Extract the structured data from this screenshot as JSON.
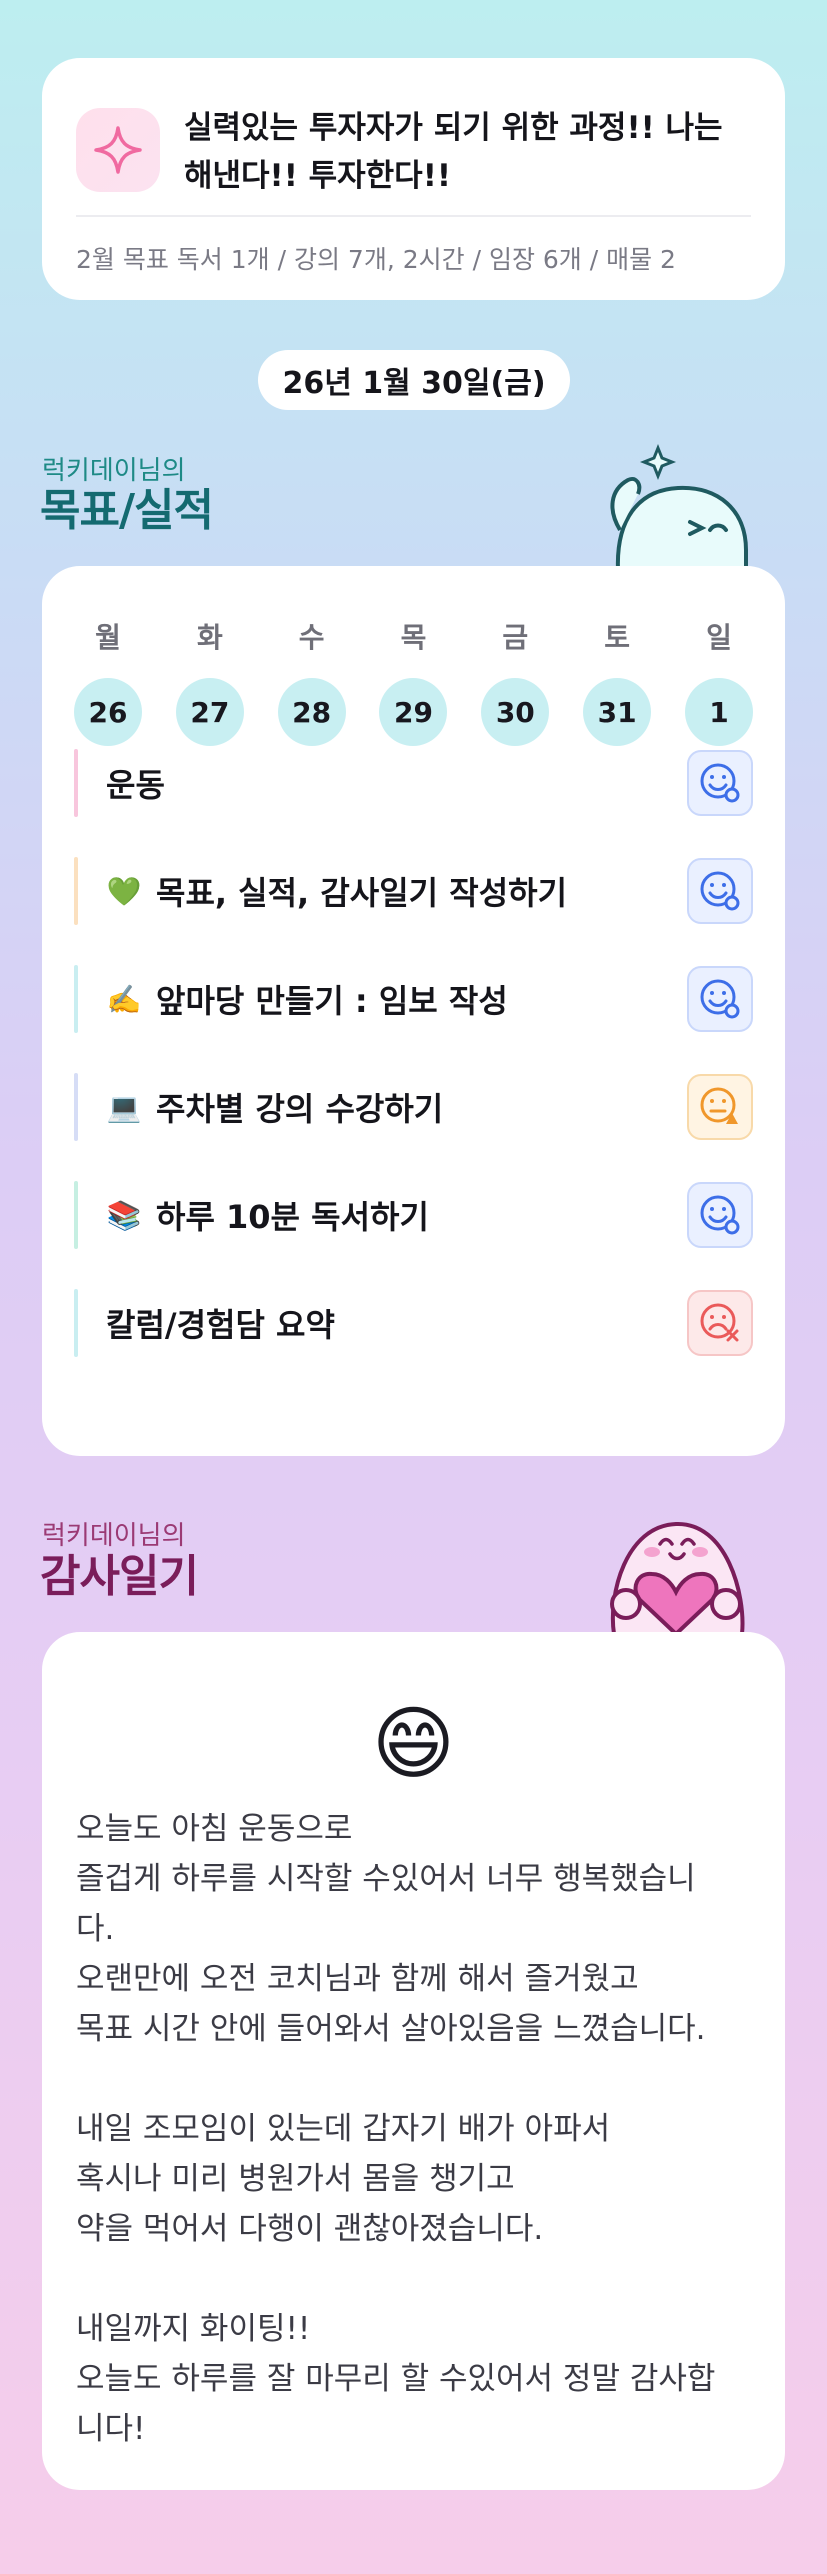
{
  "goal": {
    "text": "실력있는 투자자가 되기 위한 과정!! 나는 해낸다!! 투자한다!!",
    "subtitle": "2월 목표  독서 1개 / 강의 7개, 2시간 / 임장 6개 / 매물 2",
    "icon": "sparkle-icon",
    "accent": "#f06aa0"
  },
  "date": "26년 1월 30일(금)",
  "goals_section": {
    "small_title": "럭키데이님의",
    "big_title": "목표/실적"
  },
  "week": [
    {
      "day": "월",
      "date": "26"
    },
    {
      "day": "화",
      "date": "27"
    },
    {
      "day": "수",
      "date": "28"
    },
    {
      "day": "목",
      "date": "29"
    },
    {
      "day": "금",
      "date": "30"
    },
    {
      "day": "토",
      "date": "31"
    },
    {
      "day": "일",
      "date": "1"
    }
  ],
  "tasks": [
    {
      "emoji": "",
      "label": "운동",
      "status": "good",
      "bar_color": "#f8c6dd"
    },
    {
      "emoji": "💚",
      "label": "목표, 실적, 감사일기 작성하기",
      "status": "good",
      "bar_color": "#fbe0bf"
    },
    {
      "emoji": "✍️",
      "label": "앞마당 만들기 : 임보 작성",
      "status": "good",
      "bar_color": "#c9eef1"
    },
    {
      "emoji": "💻",
      "label": "주차별 강의 수강하기",
      "status": "warning",
      "bar_color": "#d6ddf6"
    },
    {
      "emoji": "📚",
      "label": "하루 10분 독서하기",
      "status": "good",
      "bar_color": "#c6efe2"
    },
    {
      "emoji": "",
      "label": "칼럼/경험담 요약",
      "status": "bad",
      "bar_color": "#c9eef1"
    }
  ],
  "status_colors": {
    "good": "#3d6ee8",
    "warning": "#f0972b",
    "bad": "#ea5a5a"
  },
  "diary_section": {
    "small_title": "럭키데이님의",
    "big_title": "감사일기"
  },
  "diary": {
    "emoji": "😄",
    "text": "오늘도 아침 운동으로\n즐겁게 하루를 시작할 수있어서 너무 행복했습니\n다.\n오랜만에 오전 코치님과 함께 해서 즐거웠고\n목표 시간 안에 들어와서 살아있음을 느꼈습니다.\n\n내일 조모임이 있는데 갑자기 배가 아파서\n혹시나 미리 병원가서 몸을 챙기고\n약을 먹어서 다행이 괜찮아졌습니다.\n\n내일까지 화이팅!!\n오늘도 하루를 잘 마무리 할 수있어서 정말 감사합\n니다!"
  }
}
